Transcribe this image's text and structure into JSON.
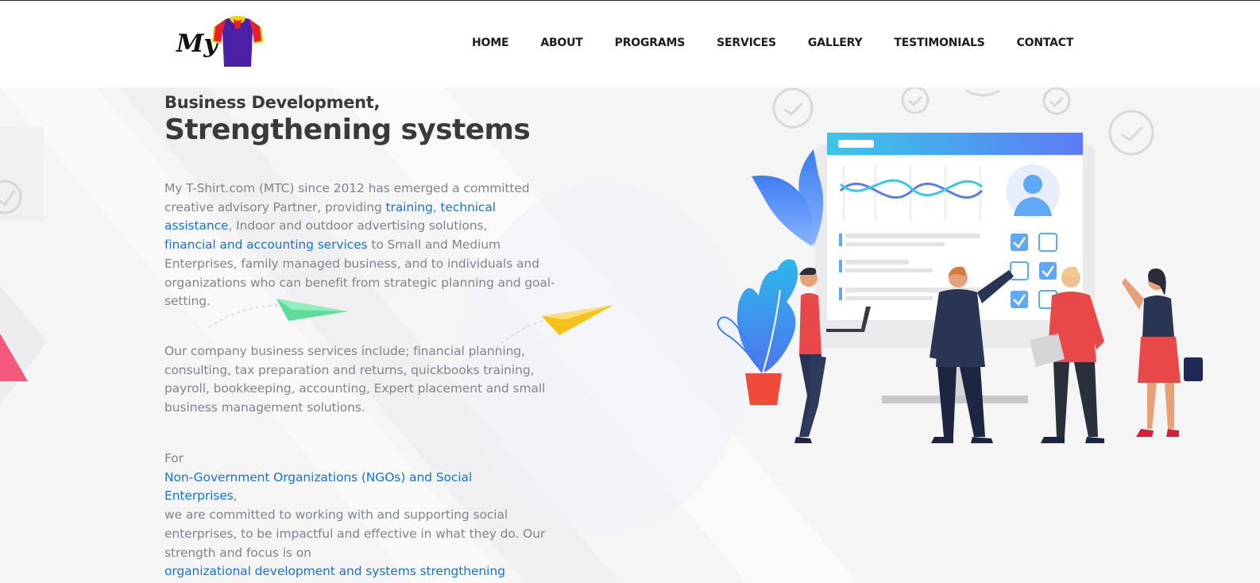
{
  "logo": {
    "text": "My"
  },
  "nav": {
    "items": [
      {
        "label": "HOME"
      },
      {
        "label": "ABOUT"
      },
      {
        "label": "PROGRAMS"
      },
      {
        "label": "SERVICES"
      },
      {
        "label": "GALLERY"
      },
      {
        "label": "TESTIMONIALS"
      },
      {
        "label": "CONTACT"
      }
    ]
  },
  "hero": {
    "eyebrow": "Business Development,",
    "title": "Strengthening systems",
    "p1": {
      "t1": "My T-Shirt.com (MTC) since 2012 has emerged a committed creative advisory Partner, providing ",
      "link_training": "training",
      "sep": ", ",
      "link_technical": "technical assistance",
      "t2": ", Indoor and outdoor advertising solutions,",
      "link_financial": "financial and accounting services",
      "t3": " to Small and Medium Enterprises, family managed business, and to individuals and organizations who can benefit from strategic planning and goal-setting."
    },
    "p2": "Our company business services include; financial planning, consulting, tax preparation and returns, quickbooks training, payroll, bookkeeping, accounting, Expert placement and small business management solutions.",
    "p3": {
      "t1": "For",
      "link_ngo": "Non-Government Organizations (NGOs) and Social Enterprises",
      "t2": ",",
      "t3": "we are committed to working with and supporting social enterprises, to be impactful and effective in what they do. Our strength and focus is on",
      "link_org": "organizational development and systems strengthening"
    }
  },
  "colors": {
    "link": "#1a73d0",
    "heading": "#3a3a3c",
    "body_text": "#80858c",
    "nav_text": "#1d1d1f",
    "shirt_body": "#4b1fa6",
    "shirt_collar": "#f2d400",
    "shirt_sleeve": "#e8202a"
  },
  "icons": [
    "shirt-logo-icon",
    "paper-plane-icon",
    "clock-check-icon",
    "checkbox-icon",
    "user-avatar-icon"
  ]
}
